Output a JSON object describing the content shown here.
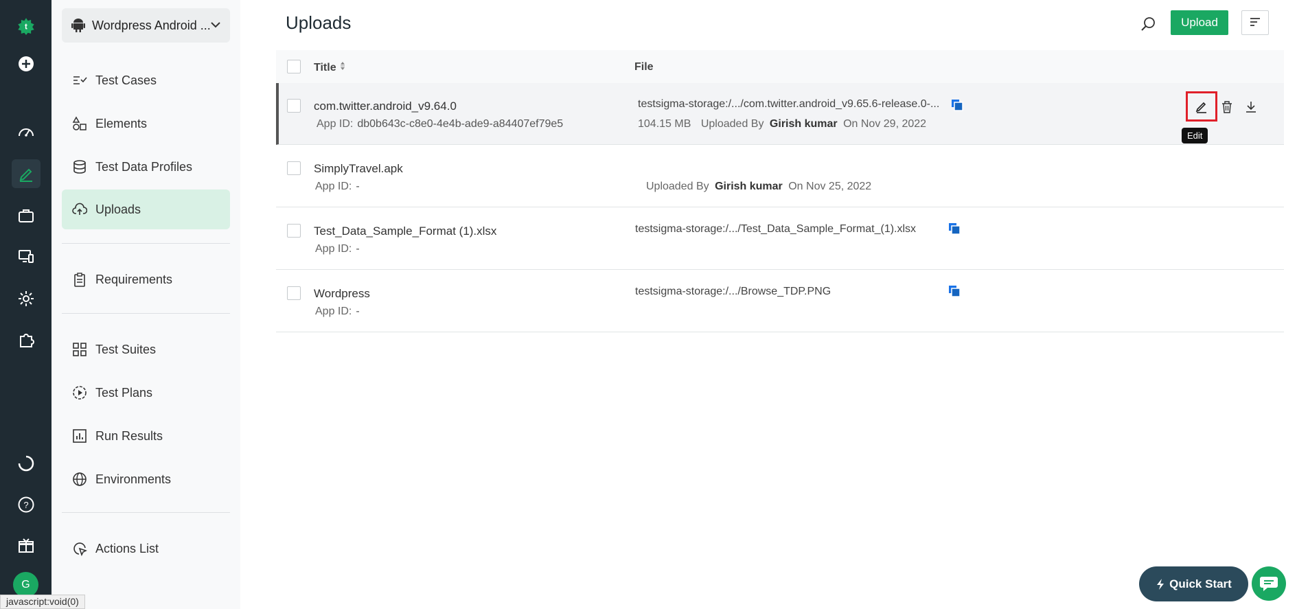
{
  "rail": {
    "logo": "t",
    "avatar": "G"
  },
  "sidebar": {
    "project_name": "Wordpress Android ...",
    "items": [
      {
        "label": "Test Cases"
      },
      {
        "label": "Elements"
      },
      {
        "label": "Test Data Profiles"
      },
      {
        "label": "Uploads"
      },
      {
        "label": "Requirements"
      },
      {
        "label": "Test Suites"
      },
      {
        "label": "Test Plans"
      },
      {
        "label": "Run Results"
      },
      {
        "label": "Environments"
      },
      {
        "label": "Actions List"
      }
    ]
  },
  "header": {
    "title": "Uploads",
    "upload_label": "Upload"
  },
  "table": {
    "col_title": "Title",
    "col_file": "File",
    "rows": [
      {
        "title": "com.twitter.android_v9.64.0",
        "app_id_label": "App ID:",
        "app_id": "db0b643c-c8e0-4e4b-ade9-a84407ef79e5",
        "file": "testsigma-storage:/.../com.twitter.android_v9.65.6-release.0-...",
        "size": "104.15 MB",
        "uploaded_by_label": "Uploaded By",
        "uploader": "Girish kumar",
        "date": "On Nov 29, 2022"
      },
      {
        "title": "SimplyTravel.apk",
        "app_id_label": "App ID:",
        "app_id": "-",
        "file": "",
        "size": "",
        "uploaded_by_label": "Uploaded By",
        "uploader": "Girish kumar",
        "date": "On Nov 25, 2022"
      },
      {
        "title": "Test_Data_Sample_Format (1).xlsx",
        "app_id_label": "App ID:",
        "app_id": "-",
        "file": "testsigma-storage:/.../Test_Data_Sample_Format_(1).xlsx"
      },
      {
        "title": "Wordpress",
        "app_id_label": "App ID:",
        "app_id": "-",
        "file": "testsigma-storage:/.../Browse_TDP.PNG"
      }
    ]
  },
  "tooltip": "Edit",
  "quick_start": "Quick Start",
  "status_bar": "javascript:void(0)",
  "colors": {
    "rail_bg": "#1f2b33",
    "accent": "#1aa862",
    "highlight": "#e0202a",
    "copy_icon": "#1a73e8"
  }
}
